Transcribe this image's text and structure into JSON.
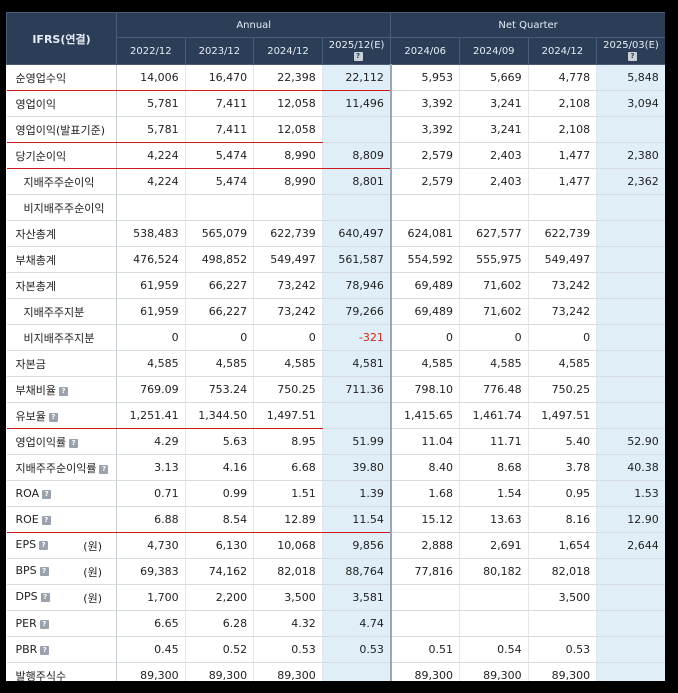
{
  "header": {
    "corner": "IFRS(연결)",
    "group_annual": "Annual",
    "group_quarter": "Net Quarter",
    "periods": [
      "2022/12",
      "2023/12",
      "2024/12",
      "2025/12(E)",
      "2024/06",
      "2024/09",
      "2024/12",
      "2025/03(E)"
    ],
    "help_icon": "?"
  },
  "rows": [
    {
      "label": "순영업수익",
      "sub": false,
      "help": false,
      "unit": "",
      "hl": "a",
      "values": [
        "14,006",
        "16,470",
        "22,398",
        "22,112",
        "5,953",
        "5,669",
        "4,778",
        "5,848"
      ]
    },
    {
      "label": "영업이익",
      "sub": false,
      "help": false,
      "unit": "",
      "hl": "",
      "values": [
        "5,781",
        "7,411",
        "12,058",
        "11,496",
        "3,392",
        "3,241",
        "2,108",
        "3,094"
      ]
    },
    {
      "label": "영업이익(발표기준)",
      "sub": false,
      "help": false,
      "unit": "",
      "hl": "b",
      "values": [
        "5,781",
        "7,411",
        "12,058",
        "",
        "3,392",
        "3,241",
        "2,108",
        ""
      ]
    },
    {
      "label": "당기순이익",
      "sub": false,
      "help": false,
      "unit": "",
      "hl": "a",
      "values": [
        "4,224",
        "5,474",
        "8,990",
        "8,809",
        "2,579",
        "2,403",
        "1,477",
        "2,380"
      ]
    },
    {
      "label": "지배주주순이익",
      "sub": true,
      "help": false,
      "unit": "",
      "hl": "",
      "values": [
        "4,224",
        "5,474",
        "8,990",
        "8,801",
        "2,579",
        "2,403",
        "1,477",
        "2,362"
      ]
    },
    {
      "label": "비지배주주순이익",
      "sub": true,
      "help": false,
      "unit": "",
      "hl": "",
      "values": [
        "",
        "",
        "",
        "",
        "",
        "",
        "",
        ""
      ]
    },
    {
      "label": "자산총계",
      "sub": false,
      "help": false,
      "unit": "",
      "hl": "",
      "values": [
        "538,483",
        "565,079",
        "622,739",
        "640,497",
        "624,081",
        "627,577",
        "622,739",
        ""
      ]
    },
    {
      "label": "부채총계",
      "sub": false,
      "help": false,
      "unit": "",
      "hl": "",
      "values": [
        "476,524",
        "498,852",
        "549,497",
        "561,587",
        "554,592",
        "555,975",
        "549,497",
        ""
      ]
    },
    {
      "label": "자본총계",
      "sub": false,
      "help": false,
      "unit": "",
      "hl": "",
      "values": [
        "61,959",
        "66,227",
        "73,242",
        "78,946",
        "69,489",
        "71,602",
        "73,242",
        ""
      ]
    },
    {
      "label": "지배주주지분",
      "sub": true,
      "help": false,
      "unit": "",
      "hl": "",
      "values": [
        "61,959",
        "66,227",
        "73,242",
        "79,266",
        "69,489",
        "71,602",
        "73,242",
        ""
      ]
    },
    {
      "label": "비지배주주지분",
      "sub": true,
      "help": false,
      "unit": "",
      "hl": "",
      "values": [
        "0",
        "0",
        "0",
        "-321",
        "0",
        "0",
        "0",
        ""
      ]
    },
    {
      "label": "자본금",
      "sub": false,
      "help": false,
      "unit": "",
      "hl": "",
      "values": [
        "4,585",
        "4,585",
        "4,585",
        "4,581",
        "4,585",
        "4,585",
        "4,585",
        ""
      ]
    },
    {
      "label": "부채비율",
      "sub": false,
      "help": true,
      "unit": "",
      "hl": "",
      "values": [
        "769.09",
        "753.24",
        "750.25",
        "711.36",
        "798.10",
        "776.48",
        "750.25",
        ""
      ]
    },
    {
      "label": "유보율",
      "sub": false,
      "help": true,
      "unit": "",
      "hl": "b",
      "values": [
        "1,251.41",
        "1,344.50",
        "1,497.51",
        "",
        "1,415.65",
        "1,461.74",
        "1,497.51",
        ""
      ]
    },
    {
      "label": "영업이익률",
      "sub": false,
      "help": true,
      "unit": "",
      "hl": "",
      "values": [
        "4.29",
        "5.63",
        "8.95",
        "51.99",
        "11.04",
        "11.71",
        "5.40",
        "52.90"
      ]
    },
    {
      "label": "지배주주순이익률",
      "sub": false,
      "help": true,
      "unit": "",
      "hl": "",
      "values": [
        "3.13",
        "4.16",
        "6.68",
        "39.80",
        "8.40",
        "8.68",
        "3.78",
        "40.38"
      ]
    },
    {
      "label": "ROA",
      "sub": false,
      "help": true,
      "unit": "",
      "hl": "",
      "values": [
        "0.71",
        "0.99",
        "1.51",
        "1.39",
        "1.68",
        "1.54",
        "0.95",
        "1.53"
      ]
    },
    {
      "label": "ROE",
      "sub": false,
      "help": true,
      "unit": "",
      "hl": "a",
      "values": [
        "6.88",
        "8.54",
        "12.89",
        "11.54",
        "15.12",
        "13.63",
        "8.16",
        "12.90"
      ]
    },
    {
      "label": "EPS",
      "sub": false,
      "help": true,
      "unit": "(원)",
      "hl": "",
      "values": [
        "4,730",
        "6,130",
        "10,068",
        "9,856",
        "2,888",
        "2,691",
        "1,654",
        "2,644"
      ]
    },
    {
      "label": "BPS",
      "sub": false,
      "help": true,
      "unit": "(원)",
      "hl": "",
      "values": [
        "69,383",
        "74,162",
        "82,018",
        "88,764",
        "77,816",
        "80,182",
        "82,018",
        ""
      ]
    },
    {
      "label": "DPS",
      "sub": false,
      "help": true,
      "unit": "(원)",
      "hl": "",
      "values": [
        "1,700",
        "2,200",
        "3,500",
        "3,581",
        "",
        "",
        "3,500",
        ""
      ]
    },
    {
      "label": "PER",
      "sub": false,
      "help": true,
      "unit": "",
      "hl": "",
      "values": [
        "6.65",
        "6.28",
        "4.32",
        "4.74",
        "",
        "",
        "",
        ""
      ]
    },
    {
      "label": "PBR",
      "sub": false,
      "help": true,
      "unit": "",
      "hl": "",
      "values": [
        "0.45",
        "0.52",
        "0.53",
        "0.53",
        "0.51",
        "0.54",
        "0.53",
        ""
      ]
    },
    {
      "label": "발행주식수",
      "sub": false,
      "help": false,
      "unit": "",
      "hl": "",
      "values": [
        "89,300",
        "89,300",
        "89,300",
        "",
        "89,300",
        "89,300",
        "89,300",
        ""
      ]
    }
  ],
  "colors": {
    "header_bg": "#2c3e57",
    "estimate_bg": "#dfeef7",
    "highlight_line": "#cc1a1a",
    "negative": "#d0261f"
  }
}
